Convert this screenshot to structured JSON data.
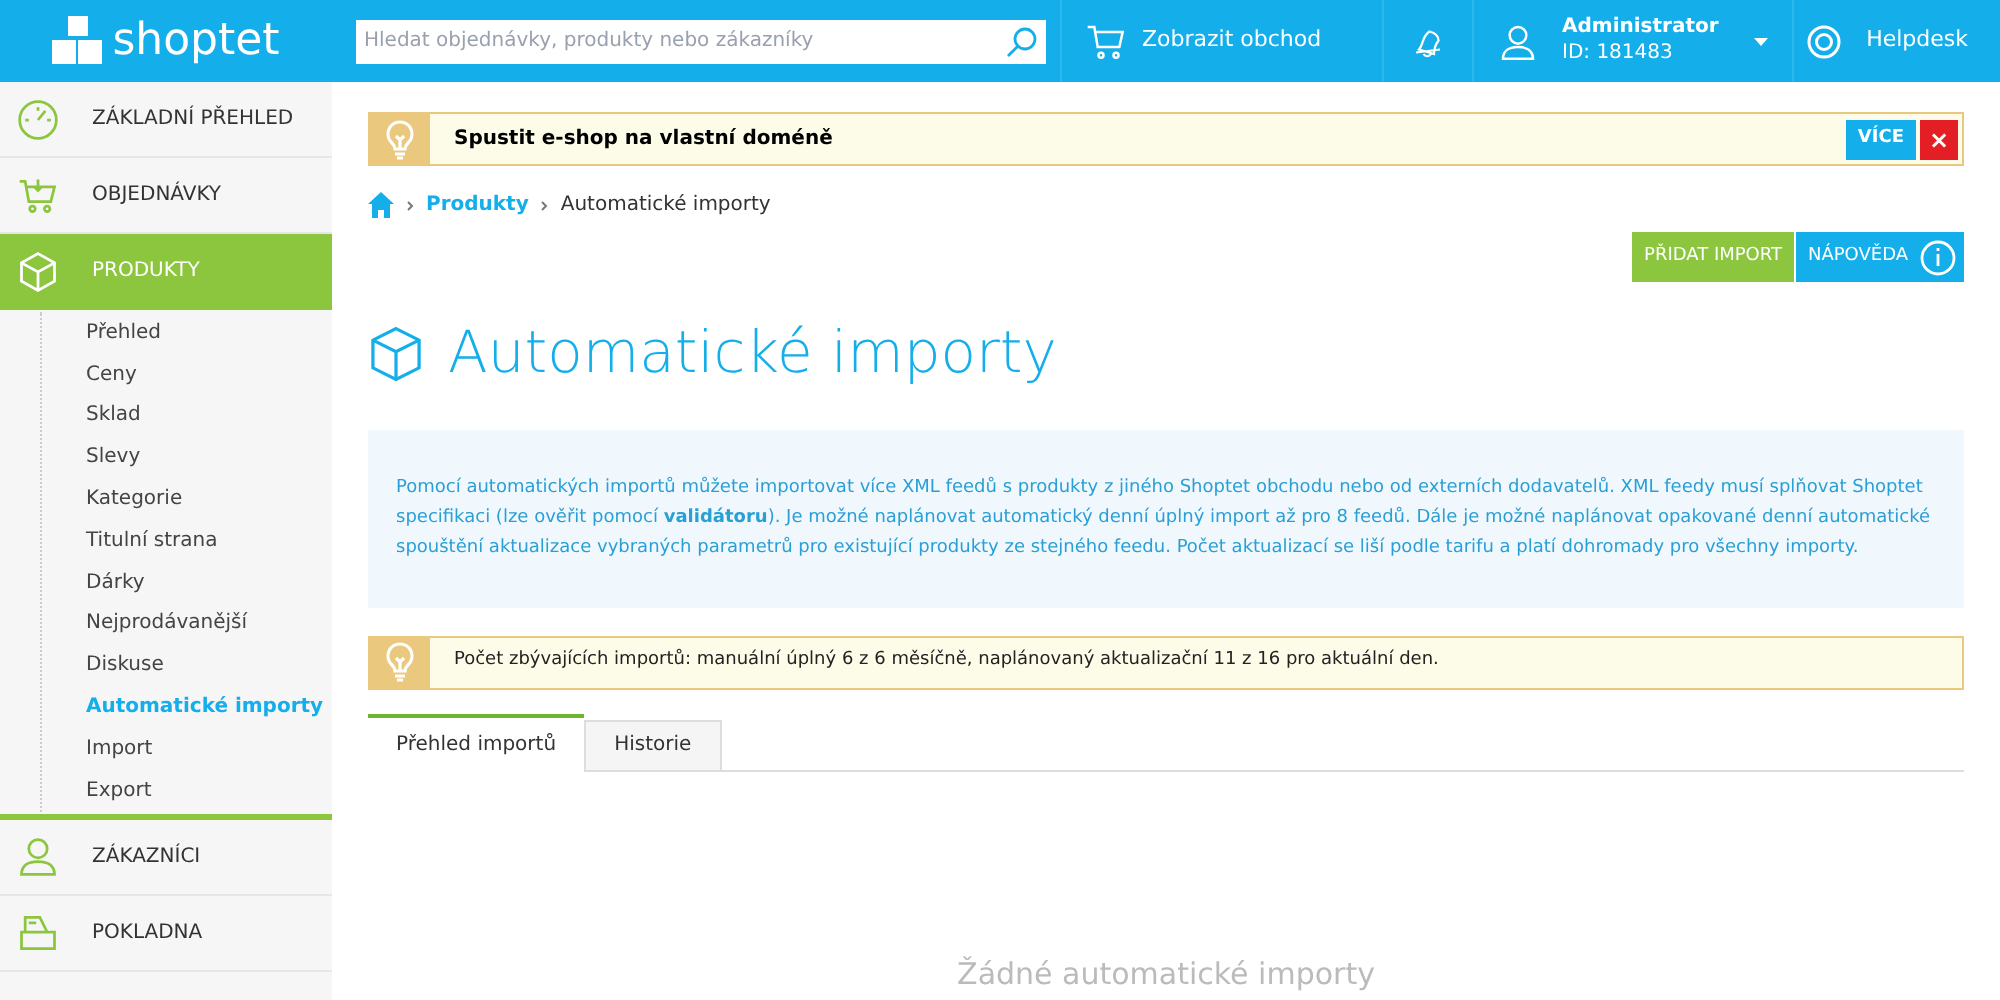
{
  "header": {
    "logo": "shoptet",
    "search": {
      "placeholder": "Hledat objednávky, produkty nebo zákazníky"
    },
    "shop_link": "Zobrazit obchod",
    "user": {
      "name": "Administrator",
      "id": "ID: 181483"
    },
    "helpdesk": "Helpdesk"
  },
  "sidebar": {
    "items": [
      {
        "label": "ZÁKLADNÍ PŘEHLED",
        "selected": false
      },
      {
        "label": "OBJEDNÁVKY",
        "selected": false
      },
      {
        "label": "PRODUKTY",
        "selected": true,
        "children": [
          {
            "label": "Přehled",
            "selected": false
          },
          {
            "label": "Ceny",
            "selected": false
          },
          {
            "label": "Sklad",
            "selected": false
          },
          {
            "label": "Slevy",
            "selected": false
          },
          {
            "label": "Kategorie",
            "selected": false
          },
          {
            "label": "Titulní strana",
            "selected": false
          },
          {
            "label": "Dárky",
            "selected": false
          },
          {
            "label": "Nejprodávanější",
            "selected": false
          },
          {
            "label": "Diskuse",
            "selected": false
          },
          {
            "label": "Automatické importy",
            "selected": true
          },
          {
            "label": "Import",
            "selected": false
          },
          {
            "label": "Export",
            "selected": false
          }
        ]
      },
      {
        "label": "ZÁKAZNÍCI",
        "selected": false
      },
      {
        "label": "POKLADNA",
        "selected": false
      }
    ]
  },
  "banner": {
    "text": "Spustit e-shop na vlastní doméně",
    "more": "VÍCE",
    "close": "×"
  },
  "breadcrumb": [
    {
      "label": "Produkty",
      "link": true
    },
    {
      "label": "Automatické importy",
      "link": false
    }
  ],
  "actions": {
    "add": "PŘIDAT IMPORT",
    "help": "NÁPOVĚDA"
  },
  "title": "Automatické importy",
  "info": "Pomocí automatických importů můžete importovat více XML feedů s produkty z jiného Shoptet obchodu nebo od externích dodavatelů. XML feedy musí splňovat Shoptet specifikaci (lze ověřit pomocí **validátoru**). Je možné naplánovat automatický denní úplný import až pro 8 feedů. Dále je možné naplánovat opakované denní automatické spouštění aktualizace vybraných parametrů pro existující produkty ze stejného feedu. Počet aktualizací se liší podle tarifu a platí dohromady pro všechny importy.",
  "notice": "Počet zbývajících importů: manuální úplný 6 z 6 měsíčně, naplánovaný aktualizační 11 z 16 pro aktuální den.",
  "tabs": [
    {
      "label": "Přehled importů",
      "selected": true
    },
    {
      "label": "Historie",
      "selected": false
    }
  ],
  "empty": "Žádné automatické importy"
}
